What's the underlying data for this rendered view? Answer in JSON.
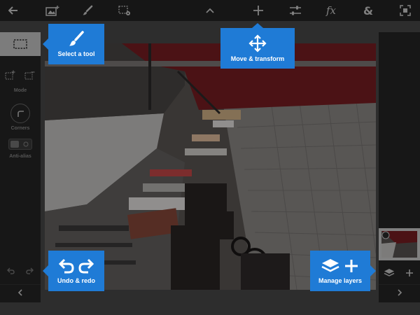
{
  "toolbar": {
    "items": [
      "back-arrow-icon",
      "add-image-icon",
      "brush-icon",
      "selection-settings-icon",
      "chevron-up-icon",
      "move-icon",
      "adjustments-icon",
      "effects-fx-icon",
      "ampersand-icon",
      "fullscreen-icon"
    ],
    "fx_text": "fx",
    "amp_text": "&"
  },
  "left_panel": {
    "mode_label": "Mode",
    "corners_label": "Corners",
    "antialias_label": "Anti-alias"
  },
  "coach_marks": {
    "select_tool": "Select a tool",
    "move_transform": "Move & transform",
    "undo_redo": "Undo & redo",
    "manage_layers": "Manage layers"
  },
  "colors": {
    "accent_blue": "#1f7bd6",
    "toolbar_bg": "#242424",
    "panel_bg": "#262626"
  }
}
